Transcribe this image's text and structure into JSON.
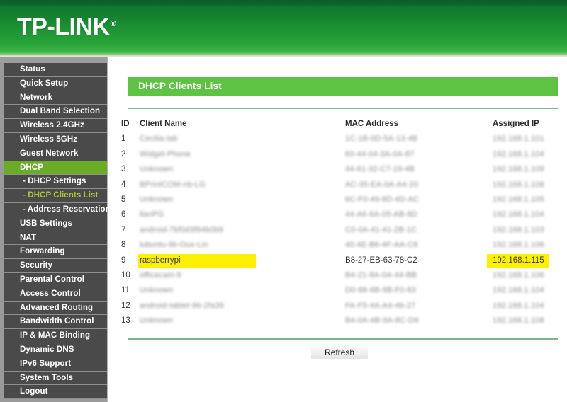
{
  "brand": {
    "name": "TP-LINK",
    "trademark": "®"
  },
  "sidebar": {
    "items": [
      {
        "label": "Status",
        "state": "normal"
      },
      {
        "label": "Quick Setup",
        "state": "normal"
      },
      {
        "label": "Network",
        "state": "normal"
      },
      {
        "label": "Dual Band Selection",
        "state": "normal"
      },
      {
        "label": "Wireless 2.4GHz",
        "state": "normal"
      },
      {
        "label": "Wireless 5GHz",
        "state": "normal"
      },
      {
        "label": "Guest Network",
        "state": "normal"
      },
      {
        "label": "DHCP",
        "state": "active"
      },
      {
        "label": "- DHCP Settings",
        "state": "sub"
      },
      {
        "label": "- DHCP Clients List",
        "state": "current"
      },
      {
        "label": "- Address Reservation",
        "state": "sub"
      },
      {
        "label": "USB Settings",
        "state": "normal"
      },
      {
        "label": "NAT",
        "state": "normal"
      },
      {
        "label": "Forwarding",
        "state": "normal"
      },
      {
        "label": "Security",
        "state": "normal"
      },
      {
        "label": "Parental Control",
        "state": "normal"
      },
      {
        "label": "Access Control",
        "state": "normal"
      },
      {
        "label": "Advanced Routing",
        "state": "normal"
      },
      {
        "label": "Bandwidth Control",
        "state": "normal"
      },
      {
        "label": "IP & MAC Binding",
        "state": "normal"
      },
      {
        "label": "Dynamic DNS",
        "state": "normal"
      },
      {
        "label": "IPv6 Support",
        "state": "normal"
      },
      {
        "label": "System Tools",
        "state": "normal"
      },
      {
        "label": "Logout",
        "state": "normal"
      }
    ]
  },
  "main": {
    "section_title": "DHCP Clients List",
    "columns": [
      "ID",
      "Client Name",
      "MAC Address",
      "Assigned IP"
    ],
    "rows": [
      {
        "id": "1",
        "name": "Cecilia-lab",
        "mac": "1C-1B-0D-5A-13-4B",
        "ip": "192.168.1.101",
        "redacted": true,
        "highlight": false
      },
      {
        "id": "2",
        "name": "Widget-Phone",
        "mac": "60-44-04-3A-0A-87",
        "ip": "192.168.1.104",
        "redacted": true,
        "highlight": false
      },
      {
        "id": "3",
        "name": "Unknown",
        "mac": "44-61-32-C7-19-4B",
        "ip": "192.168.1.109",
        "redacted": true,
        "highlight": false
      },
      {
        "id": "4",
        "name": "BPrintCOM-nb-LG",
        "mac": "AC-35-EA-0A-A4-20",
        "ip": "192.168.1.108",
        "redacted": true,
        "highlight": false
      },
      {
        "id": "5",
        "name": "Unknown",
        "mac": "6C-F0-49-8D-4D-AC",
        "ip": "192.168.1.105",
        "redacted": true,
        "highlight": false
      },
      {
        "id": "6",
        "name": "llanPG",
        "mac": "44-A6-6A-05-AB-8D",
        "ip": "192.168.1.104",
        "redacted": true,
        "highlight": false
      },
      {
        "id": "7",
        "name": "android-7bf0d3f84b0b9",
        "mac": "C0-0A-41-41-2B-1C",
        "ip": "192.168.1.103",
        "redacted": true,
        "highlight": false
      },
      {
        "id": "8",
        "name": "lubuntu-lib-Oux-Lin",
        "mac": "40-4E-B6-4F-AA-C8",
        "ip": "192.168.1.106",
        "redacted": true,
        "highlight": false
      },
      {
        "id": "9",
        "name": "raspberrypi",
        "mac": "B8-27-EB-63-78-C2",
        "ip": "192.168.1.115",
        "redacted": false,
        "highlight": true
      },
      {
        "id": "10",
        "name": "officecam-9",
        "mac": "B4-21-8A-0A-44-BB",
        "ip": "192.168.1.106",
        "redacted": true,
        "highlight": false
      },
      {
        "id": "11",
        "name": "Unknown",
        "mac": "D0-88-6B-9B-F0-83",
        "ip": "192.168.1.104",
        "redacted": true,
        "highlight": false
      },
      {
        "id": "12",
        "name": "android-tablet-96-2fa39",
        "mac": "FA-F5-4A-A4-4b-27",
        "ip": "192.168.1.104",
        "redacted": true,
        "highlight": false
      },
      {
        "id": "13",
        "name": "Unknown",
        "mac": "B4-0A-4B-9A-8C-D9",
        "ip": "192.168.1.108",
        "redacted": true,
        "highlight": false
      }
    ],
    "refresh_label": "Refresh"
  },
  "colors": {
    "banner_green_dark": "#0d6b2c",
    "banner_green_light": "#3cb447",
    "section_green": "#5ec342",
    "sidebar_item": "#4a4a4a",
    "sidebar_active": "#6aab28",
    "sidebar_current_text": "#b0c33c",
    "highlight_yellow": "#fff000"
  }
}
